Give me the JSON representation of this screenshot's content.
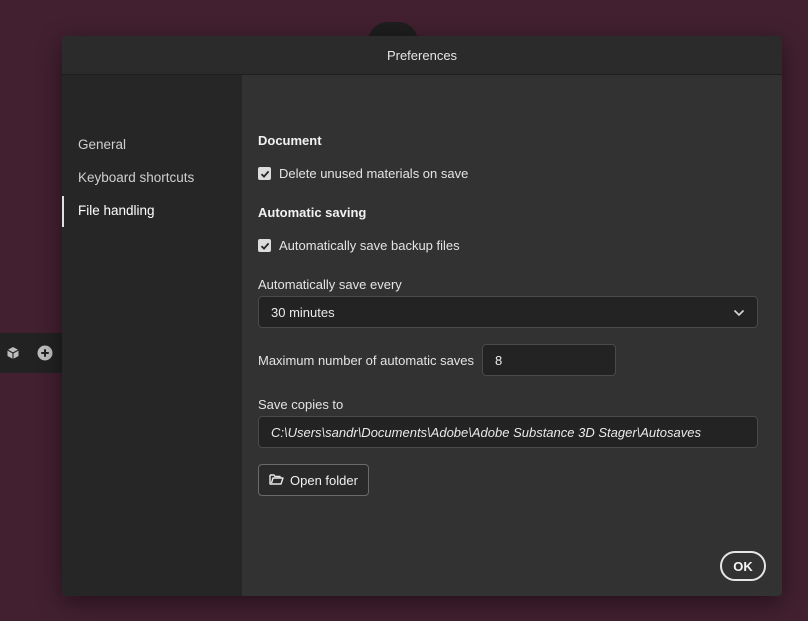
{
  "dialog": {
    "title": "Preferences"
  },
  "sidebar": {
    "items": [
      {
        "label": "General"
      },
      {
        "label": "Keyboard shortcuts"
      },
      {
        "label": "File handling"
      }
    ]
  },
  "content": {
    "document_section": "Document",
    "delete_unused": {
      "label": "Delete unused materials on save",
      "checked": true
    },
    "autosave_section": "Automatic saving",
    "auto_backup": {
      "label": "Automatically save backup files",
      "checked": true
    },
    "save_every_label": "Automatically save every",
    "save_every_value": "30 minutes",
    "max_saves_label": "Maximum number of automatic saves",
    "max_saves_value": "8",
    "save_copies_label": "Save copies to",
    "save_copies_path": "C:\\Users\\sandr\\Documents\\Adobe\\Adobe Substance 3D Stager\\Autosaves",
    "open_folder_label": "Open folder"
  },
  "footer": {
    "ok_label": "OK"
  },
  "icons": [
    "cube-icon",
    "add-circle-icon",
    "checkmark-icon",
    "chevron-down-icon",
    "folder-open-icon"
  ]
}
